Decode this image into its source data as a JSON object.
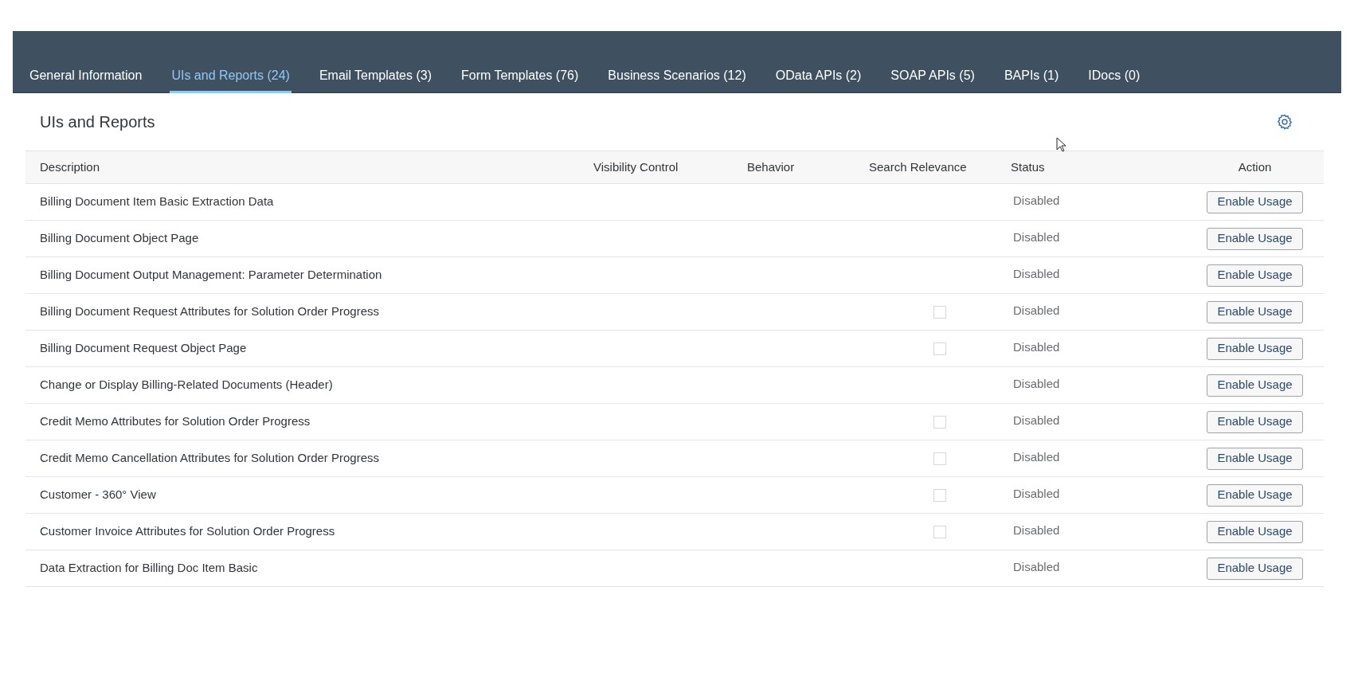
{
  "tabs": [
    {
      "label": "General Information",
      "selected": false
    },
    {
      "label": "UIs and Reports (24)",
      "selected": true
    },
    {
      "label": "Email Templates (3)",
      "selected": false
    },
    {
      "label": "Form Templates (76)",
      "selected": false
    },
    {
      "label": "Business Scenarios (12)",
      "selected": false
    },
    {
      "label": "OData APIs (2)",
      "selected": false
    },
    {
      "label": "SOAP APIs (5)",
      "selected": false
    },
    {
      "label": "BAPIs (1)",
      "selected": false
    },
    {
      "label": "IDocs (0)",
      "selected": false
    }
  ],
  "section_title": "UIs and Reports",
  "table": {
    "columns": [
      "Description",
      "Visibility Control",
      "Behavior",
      "Search Relevance",
      "Status",
      "Action"
    ],
    "rows": [
      {
        "description": "Billing Document Item Basic Extraction Data",
        "status": "Disabled",
        "action": "Enable Usage"
      },
      {
        "description": "Billing Document Object Page",
        "status": "Disabled",
        "action": "Enable Usage"
      },
      {
        "description": "Billing Document Output Management: Parameter Determination",
        "status": "Disabled",
        "action": "Enable Usage"
      },
      {
        "description": "Billing Document Request Attributes for Solution Order Progress",
        "search_relevance": {
          "checked": false
        },
        "status": "Disabled",
        "action": "Enable Usage"
      },
      {
        "description": "Billing Document Request Object Page",
        "search_relevance": {
          "checked": false
        },
        "status": "Disabled",
        "action": "Enable Usage"
      },
      {
        "description": "Change or Display Billing-Related Documents (Header)",
        "status": "Disabled",
        "action": "Enable Usage"
      },
      {
        "description": "Credit Memo Attributes for Solution Order Progress",
        "search_relevance": {
          "checked": false
        },
        "status": "Disabled",
        "action": "Enable Usage"
      },
      {
        "description": "Credit Memo Cancellation Attributes for Solution Order Progress",
        "search_relevance": {
          "checked": false
        },
        "status": "Disabled",
        "action": "Enable Usage"
      },
      {
        "description": "Customer - 360° View",
        "search_relevance": {
          "checked": false
        },
        "status": "Disabled",
        "action": "Enable Usage"
      },
      {
        "description": "Customer Invoice Attributes for Solution Order Progress",
        "search_relevance": {
          "checked": false
        },
        "status": "Disabled",
        "action": "Enable Usage"
      },
      {
        "description": "Data Extraction for Billing Doc Item Basic",
        "status": "Disabled",
        "action": "Enable Usage"
      }
    ]
  }
}
